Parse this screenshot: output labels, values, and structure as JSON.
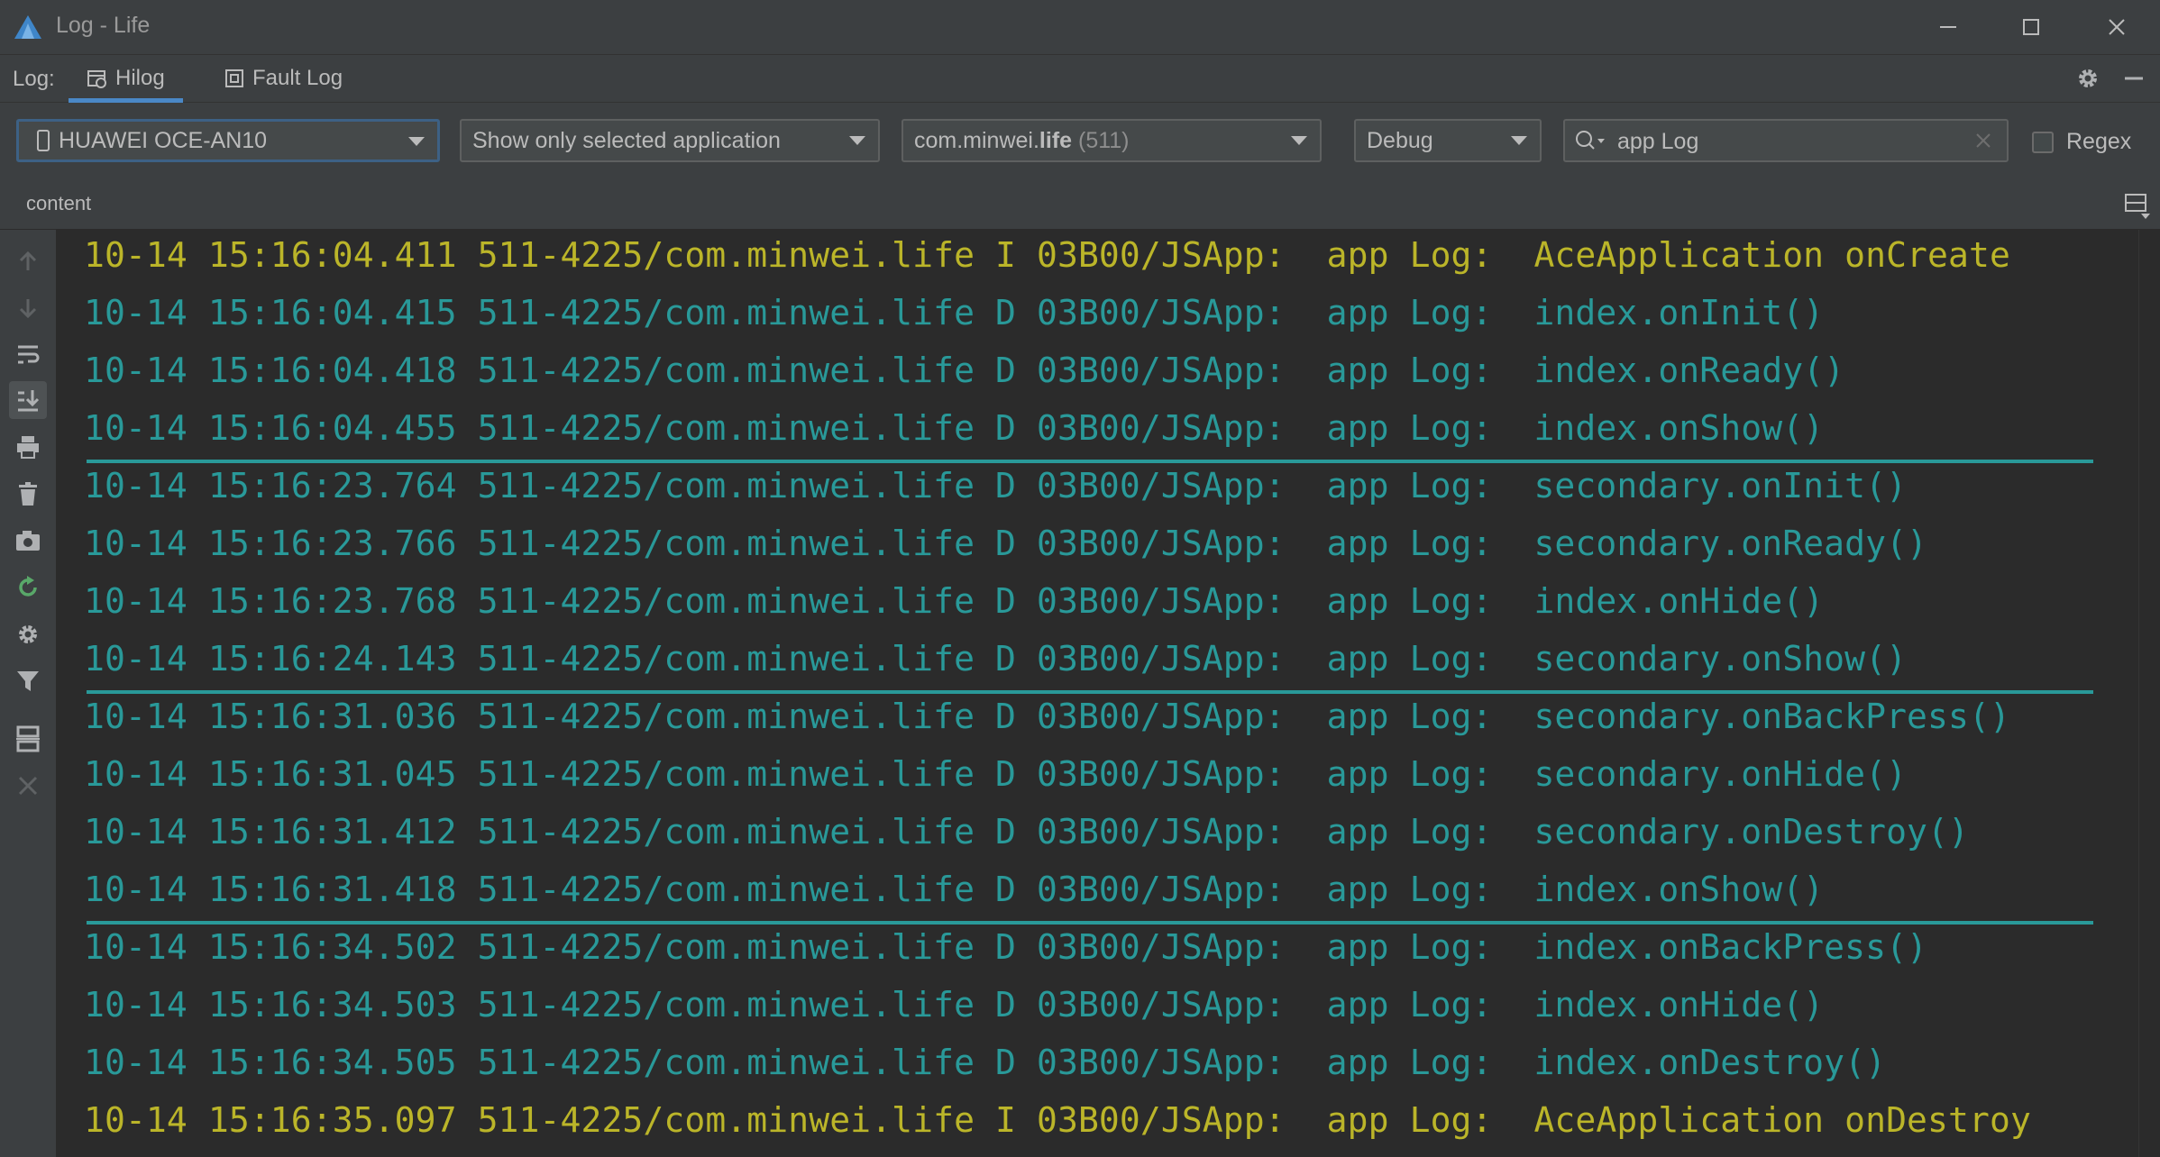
{
  "window": {
    "title": "Log - Life",
    "logo_icon": "deveco-logo-icon",
    "controls": [
      "minimize-icon",
      "maximize-icon",
      "close-icon"
    ]
  },
  "tabbar": {
    "label": "Log:",
    "tabs": [
      {
        "label": "Hilog",
        "icon": "hilog-icon",
        "active": true
      },
      {
        "label": "Fault Log",
        "icon": "fault-log-icon",
        "active": false
      }
    ],
    "right_icons": [
      "gear-icon",
      "minimize-panel-icon"
    ]
  },
  "filters": {
    "device": "HUAWEI OCE-AN10",
    "scope": "Show only selected application",
    "process_name": "com.minwei.",
    "process_bold": "life",
    "process_count": " (511)",
    "level": "Debug",
    "search_value": "app Log",
    "regex_label": "Regex",
    "regex_checked": false
  },
  "columns": {
    "content": "content"
  },
  "sidebar_icons": [
    "scroll-up-icon",
    "scroll-down-icon",
    "soft-wrap-icon",
    "scroll-to-end-icon",
    "print-icon",
    "clear-log-icon",
    "screenshot-icon",
    "restart-icon",
    "settings-icon",
    "filter-icon",
    "split-icon",
    "close-icon"
  ],
  "colors": {
    "info": "#bbb529",
    "debug": "#299999",
    "accent": "#4a88c7"
  },
  "log": [
    {
      "text": "10-14 15:16:04.411 511-4225/com.minwei.life I 03B00/JSApp:  app Log:  AceApplication onCreate",
      "level": "I"
    },
    {
      "text": "10-14 15:16:04.415 511-4225/com.minwei.life D 03B00/JSApp:  app Log:  index.onInit()",
      "level": "D"
    },
    {
      "text": "10-14 15:16:04.418 511-4225/com.minwei.life D 03B00/JSApp:  app Log:  index.onReady()",
      "level": "D"
    },
    {
      "text": "10-14 15:16:04.455 511-4225/com.minwei.life D 03B00/JSApp:  app Log:  index.onShow()",
      "level": "D",
      "separator_after": true
    },
    {
      "text": "10-14 15:16:23.764 511-4225/com.minwei.life D 03B00/JSApp:  app Log:  secondary.onInit()",
      "level": "D"
    },
    {
      "text": "10-14 15:16:23.766 511-4225/com.minwei.life D 03B00/JSApp:  app Log:  secondary.onReady()",
      "level": "D"
    },
    {
      "text": "10-14 15:16:23.768 511-4225/com.minwei.life D 03B00/JSApp:  app Log:  index.onHide()",
      "level": "D"
    },
    {
      "text": "10-14 15:16:24.143 511-4225/com.minwei.life D 03B00/JSApp:  app Log:  secondary.onShow()",
      "level": "D",
      "separator_after": true
    },
    {
      "text": "10-14 15:16:31.036 511-4225/com.minwei.life D 03B00/JSApp:  app Log:  secondary.onBackPress()",
      "level": "D"
    },
    {
      "text": "10-14 15:16:31.045 511-4225/com.minwei.life D 03B00/JSApp:  app Log:  secondary.onHide()",
      "level": "D"
    },
    {
      "text": "10-14 15:16:31.412 511-4225/com.minwei.life D 03B00/JSApp:  app Log:  secondary.onDestroy()",
      "level": "D"
    },
    {
      "text": "10-14 15:16:31.418 511-4225/com.minwei.life D 03B00/JSApp:  app Log:  index.onShow()",
      "level": "D",
      "separator_after": true
    },
    {
      "text": "10-14 15:16:34.502 511-4225/com.minwei.life D 03B00/JSApp:  app Log:  index.onBackPress()",
      "level": "D"
    },
    {
      "text": "10-14 15:16:34.503 511-4225/com.minwei.life D 03B00/JSApp:  app Log:  index.onHide()",
      "level": "D"
    },
    {
      "text": "10-14 15:16:34.505 511-4225/com.minwei.life D 03B00/JSApp:  app Log:  index.onDestroy()",
      "level": "D"
    },
    {
      "text": "10-14 15:16:35.097 511-4225/com.minwei.life I 03B00/JSApp:  app Log:  AceApplication onDestroy",
      "level": "I"
    }
  ]
}
